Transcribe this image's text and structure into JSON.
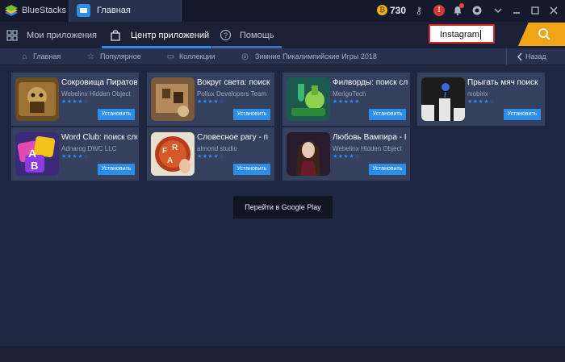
{
  "titlebar": {
    "app_name": "BlueStacks",
    "tab_home": "Главная",
    "coins": "730",
    "icons": [
      "key-icon",
      "alert-icon",
      "bell-icon",
      "circle-icon",
      "minimize-icon",
      "maximize-icon",
      "close-icon"
    ]
  },
  "nav": {
    "my_apps": "Мои приложения",
    "app_center": "Центр приложений",
    "help": "Помощь"
  },
  "search": {
    "value": "Instagram"
  },
  "subnav": {
    "home": "Главная",
    "popular": "Популярное",
    "collections": "Коллекции",
    "olympics": "Зимние Пикалимпийские Игры 2018",
    "back": "Назад"
  },
  "apps": [
    {
      "title": "Сокровища Пиратов",
      "developer": "Webelinx Hidden Object",
      "stars": "★★★★☆",
      "install": "Установить"
    },
    {
      "title": "Вокруг света: поиск",
      "developer": "Pollux Developers Team",
      "stars": "★★★★☆",
      "install": "Установить"
    },
    {
      "title": "Филворды: поиск слов",
      "developer": "MerigoTech",
      "stars": "★★★★★",
      "install": "Установить"
    },
    {
      "title": "Прыгать мяч поиск",
      "developer": "mobirix",
      "stars": "★★★★☆",
      "install": "Установить"
    },
    {
      "title": "Word Club: поиск слов",
      "developer": "Adnarog DWC LLC",
      "stars": "★★★★☆",
      "install": "Установить"
    },
    {
      "title": "Словесное рагу - п",
      "developer": "almond studio",
      "stars": "★★★★☆",
      "install": "Установить"
    },
    {
      "title": "Любовь Вампира - I",
      "developer": "Webelinx Hidden Object",
      "stars": "★★★★☆",
      "install": "Установить"
    }
  ],
  "google_play_button": "Перейти в Google Play",
  "colors": {
    "accent_blue": "#2d8cf0",
    "search_orange": "#f0a418",
    "highlight_red": "#e0232b",
    "background": "#1f2740",
    "card": "#35405f"
  }
}
